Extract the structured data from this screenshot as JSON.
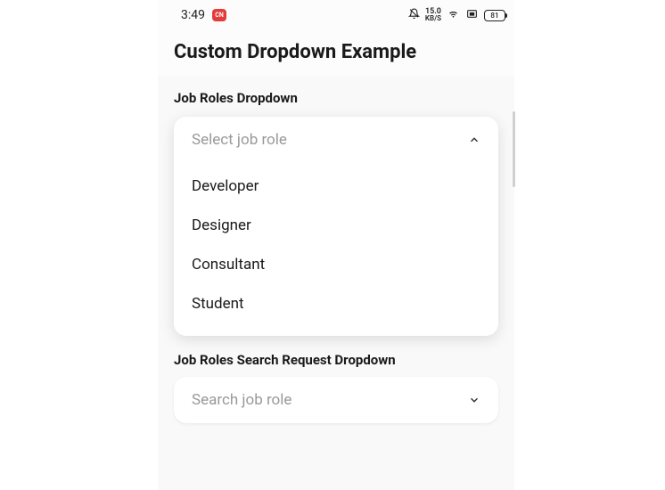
{
  "status": {
    "time": "3:49",
    "badge": "CN",
    "net_top": "15.0",
    "net_bottom": "KB/S",
    "battery": "81"
  },
  "header": {
    "title": "Custom Dropdown Example"
  },
  "dropdown1": {
    "label": "Job Roles Dropdown",
    "placeholder": "Select job role",
    "options": {
      "0": "Developer",
      "1": "Designer",
      "2": "Consultant",
      "3": "Student"
    }
  },
  "dropdown2": {
    "label": "Job Roles Search Request Dropdown",
    "placeholder": "Search job role"
  }
}
